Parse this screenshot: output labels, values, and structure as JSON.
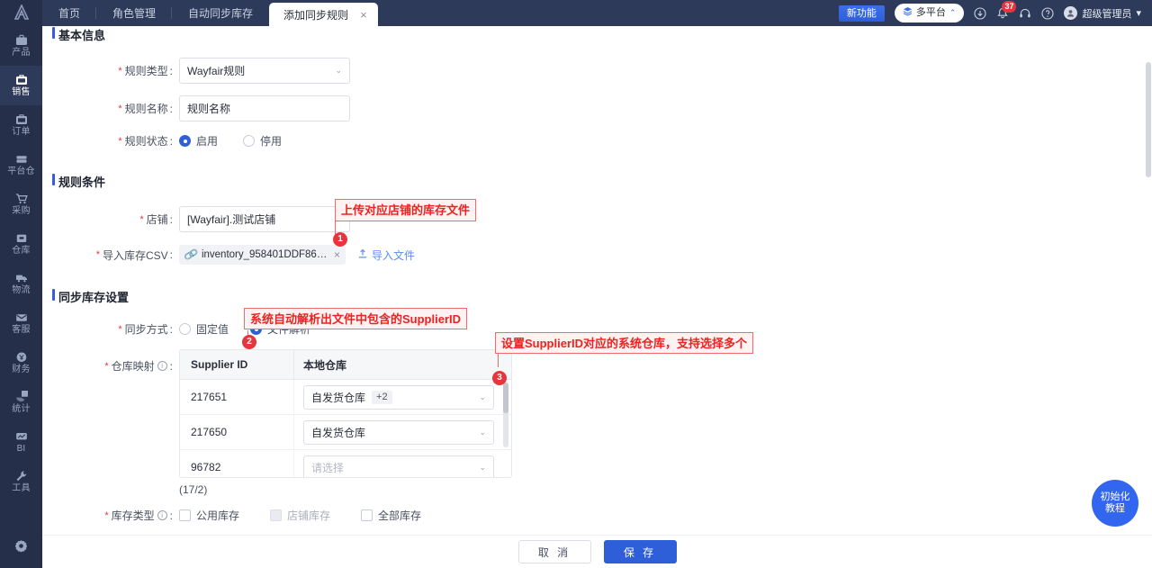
{
  "app": {
    "logo": "A"
  },
  "sidebar": {
    "items": [
      {
        "label": "产品",
        "icon": "briefcase-icon",
        "active": false
      },
      {
        "label": "销售",
        "icon": "sell-icon",
        "active": true
      },
      {
        "label": "订单",
        "icon": "order-icon",
        "active": false
      },
      {
        "label": "平台仓",
        "icon": "platform-warehouse-icon",
        "active": false
      },
      {
        "label": "采购",
        "icon": "cart-icon",
        "active": false
      },
      {
        "label": "仓库",
        "icon": "warehouse-icon",
        "active": false
      },
      {
        "label": "物流",
        "icon": "truck-icon",
        "active": false
      },
      {
        "label": "客服",
        "icon": "mail-icon",
        "active": false
      },
      {
        "label": "财务",
        "icon": "finance-icon",
        "active": false
      },
      {
        "label": "统计",
        "icon": "pie-chart-icon",
        "active": false
      },
      {
        "label": "BI",
        "icon": "bi-icon",
        "active": false
      },
      {
        "label": "工具",
        "icon": "wrench-icon",
        "active": false
      }
    ],
    "settings_icon": "gear-icon"
  },
  "topbar": {
    "tabs": [
      {
        "label": "首页",
        "active": false
      },
      {
        "label": "角色管理",
        "active": false
      },
      {
        "label": "自动同步库存",
        "active": false
      },
      {
        "label": "添加同步规则",
        "active": true,
        "close": "×"
      }
    ],
    "new_feature_badge": "新功能",
    "platform": {
      "label": "多平台",
      "icon": "layers-icon",
      "caret": "⌃"
    },
    "icons": [
      {
        "name": "download-icon"
      },
      {
        "name": "bell-icon",
        "badge": "37"
      },
      {
        "name": "headset-icon"
      },
      {
        "name": "help-icon"
      }
    ],
    "user": {
      "name": "超级管理员",
      "caret": "▾",
      "avatar": "person-icon"
    }
  },
  "form": {
    "section_basic": "基本信息",
    "section_conditions": "规则条件",
    "section_sync": "同步库存设置",
    "rule_type": {
      "label": "规则类型",
      "value": "Wayfair规则",
      "required": true
    },
    "rule_name": {
      "label": "规则名称",
      "value": "规则名称",
      "required": true
    },
    "rule_status": {
      "label": "规则状态",
      "required": true,
      "options": [
        {
          "label": "启用",
          "selected": true
        },
        {
          "label": "停用",
          "selected": false
        }
      ]
    },
    "shop": {
      "label": "店铺",
      "value": "[Wayfair].测试店铺",
      "required": true
    },
    "import_csv": {
      "label": "导入库存CSV",
      "required": true,
      "file_name": "inventory_958401DDF86C4...",
      "file_remove": "×",
      "upload_link": "导入文件",
      "upload_icon": "upload-icon",
      "clip_icon": "paperclip-icon"
    },
    "sync_mode": {
      "label": "同步方式",
      "required": true,
      "options": [
        {
          "label": "固定值",
          "selected": false
        },
        {
          "label": "文件解析",
          "selected": true
        }
      ]
    },
    "warehouse_map": {
      "label": "仓库映射",
      "required": true,
      "info_icon": "info-icon",
      "columns": [
        "Supplier ID",
        "本地仓库"
      ],
      "rows": [
        {
          "supplier_id": "217651",
          "warehouse": "自发货仓库",
          "extra": "+2",
          "placeholder": false
        },
        {
          "supplier_id": "217650",
          "warehouse": "自发货仓库",
          "extra": "",
          "placeholder": false
        },
        {
          "supplier_id": "96782",
          "warehouse": "请选择",
          "extra": "",
          "placeholder": true
        },
        {
          "supplier_id": "",
          "warehouse": "",
          "extra": "",
          "placeholder": true
        }
      ],
      "page_count": "(17/2)"
    },
    "stock_type": {
      "label": "库存类型",
      "required": true,
      "info_icon": "info-icon",
      "options": [
        {
          "label": "公用库存",
          "checked": false,
          "disabled": false
        },
        {
          "label": "店铺库存",
          "checked": false,
          "disabled": true
        },
        {
          "label": "全部库存",
          "checked": false,
          "disabled": false
        }
      ]
    }
  },
  "annotations": [
    {
      "num": "1",
      "text": "上传对应店铺的库存文件"
    },
    {
      "num": "2",
      "text": "系统自动解析出文件中包含的SupplierID"
    },
    {
      "num": "3",
      "text": "设置SupplierID对应的系统仓库，支持选择多个"
    }
  ],
  "footer": {
    "cancel": "取 消",
    "save": "保 存"
  },
  "float_button": {
    "line1": "初始化",
    "line2": "教程"
  }
}
